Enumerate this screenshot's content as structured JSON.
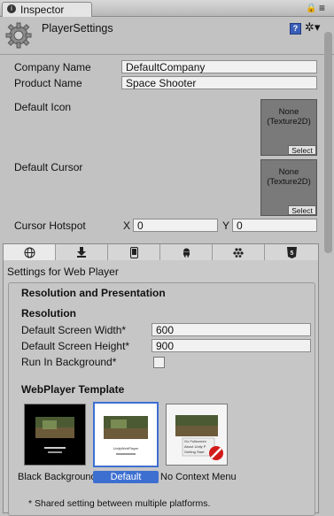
{
  "window": {
    "tab_title": "Inspector",
    "lock_icon": "lock-icon",
    "menu_icon": "menu-icon"
  },
  "header": {
    "title": "PlayerSettings",
    "icon": "gear-icon"
  },
  "fields": {
    "company_label": "Company Name",
    "company_value": "DefaultCompany",
    "product_label": "Product Name",
    "product_value": "Space Shooter",
    "default_icon_label": "Default Icon",
    "default_cursor_label": "Default Cursor",
    "texture_none_line1": "None",
    "texture_none_line2": "(Texture2D)",
    "select_label": "Select",
    "cursor_hotspot_label": "Cursor Hotspot",
    "x_label": "X",
    "x_value": "0",
    "y_label": "Y",
    "y_value": "0"
  },
  "platforms": [
    "globe-icon",
    "download-icon",
    "phone-icon",
    "android-icon",
    "blackberry-icon",
    "html5-icon"
  ],
  "settings": {
    "for_label": "Settings for Web Player",
    "section_title": "Resolution and Presentation",
    "resolution_heading": "Resolution",
    "width_label": "Default Screen Width*",
    "width_value": "600",
    "height_label": "Default Screen Height*",
    "height_value": "900",
    "run_bg_label": "Run In Background*",
    "run_bg_checked": false,
    "template_heading": "WebPlayer Template",
    "templates": [
      {
        "label": "Black Background",
        "selected": false
      },
      {
        "label": "Default",
        "selected": true
      },
      {
        "label": "No Context Menu",
        "selected": false
      }
    ],
    "template_caption": "UnityWebPlayer",
    "ctx_menu_lines": [
      "Go Fullscreen",
      "About Unity P",
      "Getting Start"
    ],
    "footnote": "* Shared setting between multiple platforms."
  },
  "colors": {
    "accent": "#3d6fd1"
  }
}
